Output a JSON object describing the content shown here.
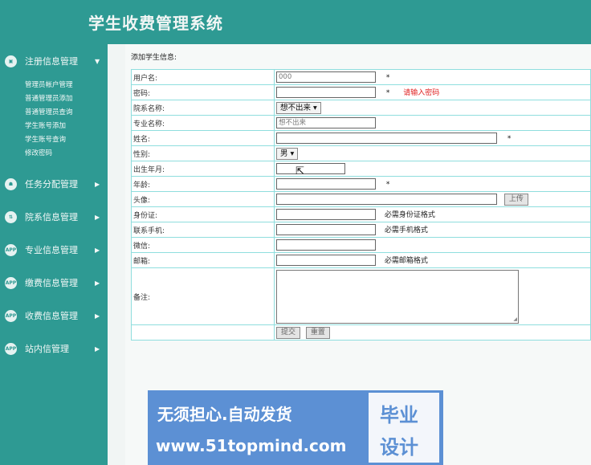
{
  "app": {
    "title": "学生收费管理系统"
  },
  "sidebar": {
    "groups": [
      {
        "label": "注册信息管理",
        "icon": "monitor-icon",
        "glyph": "▣",
        "arrow": "▼",
        "items": [
          "管理员帐户管理",
          "普通管理员添加",
          "普通管理员查询",
          "学生账号添加",
          "学生账号查询",
          "修改密码"
        ]
      },
      {
        "label": "任务分配管理",
        "icon": "users-gear-icon",
        "glyph": "☗",
        "arrow": "▶"
      },
      {
        "label": "院系信息管理",
        "icon": "transfer-icon",
        "glyph": "⇅",
        "arrow": "▶"
      },
      {
        "label": "专业信息管理",
        "icon": "app-icon",
        "glyph": "APP",
        "arrow": "▶"
      },
      {
        "label": "缴费信息管理",
        "icon": "app-icon",
        "glyph": "APP",
        "arrow": "▶"
      },
      {
        "label": "收费信息管理",
        "icon": "app-icon",
        "glyph": "APP",
        "arrow": "▶"
      },
      {
        "label": "站内信管理",
        "icon": "app-icon",
        "glyph": "APP",
        "arrow": "▶"
      }
    ]
  },
  "form": {
    "title": "添加学生信息:",
    "fields": {
      "username": {
        "label": "用户名:",
        "value": "000",
        "required": "*"
      },
      "password": {
        "label": "密码:",
        "value": "",
        "required": "*",
        "error": "请输入密码"
      },
      "department": {
        "label": "院系名称:",
        "selected": "想不出来"
      },
      "major": {
        "label": "专业名称:",
        "value": "想不出来"
      },
      "name": {
        "label": "姓名:",
        "value": "",
        "required": "*"
      },
      "gender": {
        "label": "性别:",
        "selected": "男"
      },
      "birth": {
        "label": "出生年月:",
        "value": ""
      },
      "age": {
        "label": "年龄:",
        "value": "",
        "required": "*"
      },
      "avatar": {
        "label": "头像:",
        "value": "",
        "upload_label": "上传"
      },
      "id_card": {
        "label": "身份证:",
        "value": "",
        "hint": "必需身份证格式"
      },
      "phone": {
        "label": "联系手机:",
        "value": "",
        "hint": "必需手机格式"
      },
      "wechat": {
        "label": "微信:",
        "value": ""
      },
      "email": {
        "label": "邮箱:",
        "value": "",
        "hint": "必需邮箱格式"
      },
      "remark": {
        "label": "备注:",
        "value": ""
      }
    },
    "submit_label": "提交",
    "reset_label": "重置"
  },
  "banner": {
    "slogan": "无须担心.自动发货",
    "url": "www.51topmind.com",
    "badge_line1": "毕业",
    "badge_line2": "设计"
  },
  "colors": {
    "header": "#2e9a93",
    "sidebar": "#2e9a93",
    "error": "#e02020",
    "table_border": "#8fdede",
    "banner": "#5c90d4"
  }
}
